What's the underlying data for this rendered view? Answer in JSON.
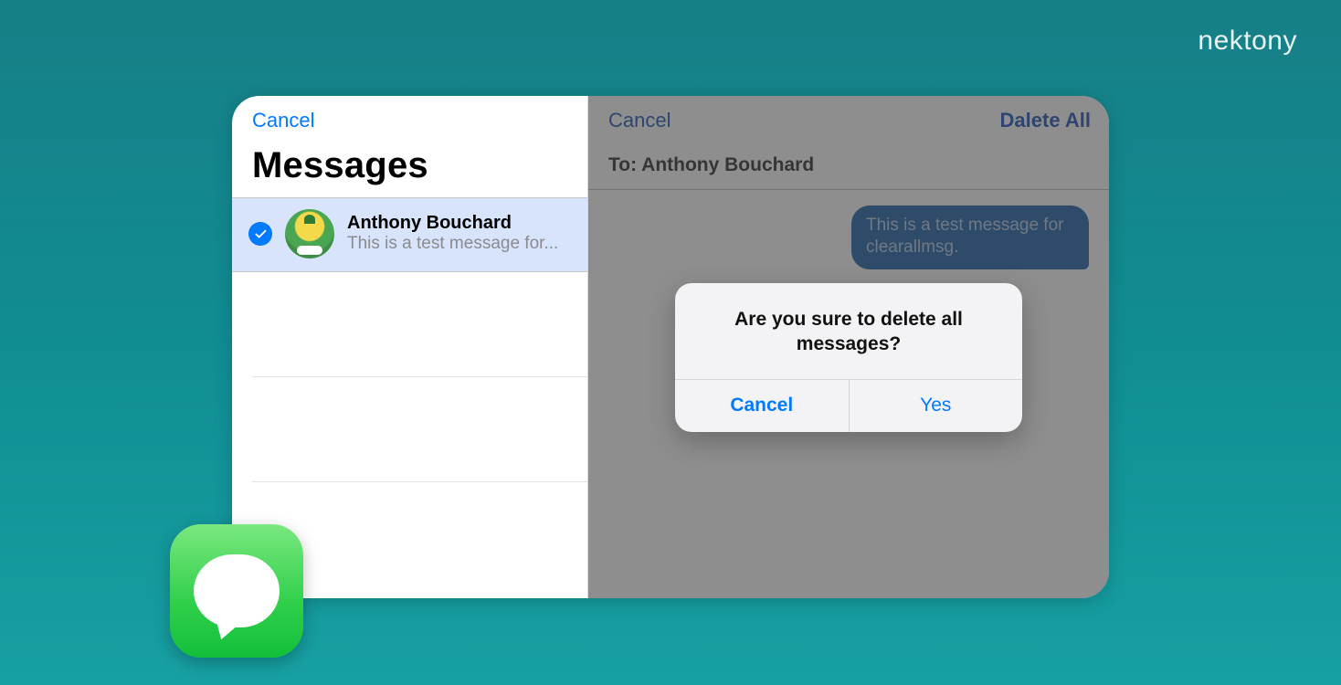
{
  "brand": "nektony",
  "left": {
    "cancel": "Cancel",
    "title": "Messages",
    "conversation": {
      "name": "Anthony Bouchard",
      "preview": "This is a test message for..."
    }
  },
  "right": {
    "cancel": "Cancel",
    "delete_all": "Dalete All",
    "to_prefix": "To:",
    "to_name": "Anthony Bouchard",
    "bubble": "This is a test message for clearallmsg."
  },
  "alert": {
    "message": "Are you sure to delete all messages?",
    "cancel": "Cancel",
    "confirm": "Yes"
  }
}
